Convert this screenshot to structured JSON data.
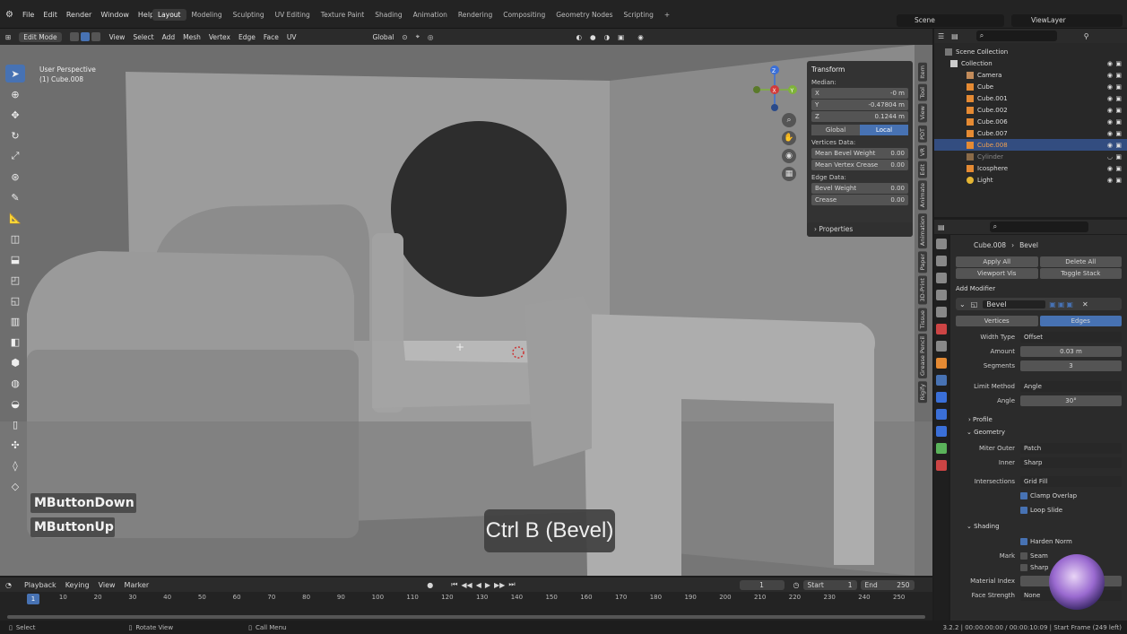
{
  "app": {
    "menu": [
      "File",
      "Edit",
      "Render",
      "Window",
      "Help"
    ],
    "workspaces": [
      "Layout",
      "Modeling",
      "Sculpting",
      "UV Editing",
      "Texture Paint",
      "Shading",
      "Animation",
      "Rendering",
      "Compositing",
      "Geometry Nodes",
      "Scripting"
    ],
    "active_workspace": "Layout",
    "scene": "Scene",
    "view_layer": "ViewLayer"
  },
  "viewport_header": {
    "mode": "Edit Mode",
    "menus": [
      "View",
      "Select",
      "Add",
      "Mesh",
      "Vertex",
      "Edge",
      "Face",
      "UV"
    ],
    "orientation": "Global",
    "options": "Options",
    "xyz": [
      "X",
      "Y",
      "Z"
    ]
  },
  "viewport": {
    "view": "User Perspective",
    "object": "(1) Cube.008"
  },
  "gizmo": {
    "x": "X",
    "y": "Y",
    "z": "Z"
  },
  "npanel": {
    "transform": "Transform",
    "median": "Median:",
    "x_label": "X",
    "x_val": "-0 m",
    "y_label": "Y",
    "y_val": "-0.47804 m",
    "z_label": "Z",
    "z_val": "0.1244 m",
    "global": "Global",
    "local": "Local",
    "vertices_data": "Vertices Data:",
    "mean_bevel_weight": "Mean Bevel Weight",
    "mbw_val": "0.00",
    "mean_vertex_crease": "Mean Vertex Crease",
    "mvc_val": "0.00",
    "edge_data": "Edge Data:",
    "bevel_weight": "Bevel Weight",
    "bw_val": "0.00",
    "crease": "Crease",
    "cr_val": "0.00",
    "properties": "Properties"
  },
  "side_tabs": [
    "Item",
    "Tool",
    "View",
    "PDT",
    "VR",
    "Edit",
    "Animate",
    "Animation",
    "Paper",
    "3D-Print",
    "Tissue",
    "Grease Pencil",
    "Rigify"
  ],
  "keys": {
    "down": "MButtonDown",
    "up": "MButtonUp"
  },
  "caption": "Ctrl B (Bevel)",
  "outliner": {
    "scene_collection": "Scene Collection",
    "collection": "Collection",
    "items": [
      {
        "name": "Camera"
      },
      {
        "name": "Cube"
      },
      {
        "name": "Cube.001"
      },
      {
        "name": "Cube.002"
      },
      {
        "name": "Cube.006"
      },
      {
        "name": "Cube.007"
      },
      {
        "name": "Cube.008"
      },
      {
        "name": "Cylinder"
      },
      {
        "name": "Icosphere"
      },
      {
        "name": "Light"
      }
    ],
    "selected": "Cube.008"
  },
  "properties": {
    "breadcrumb_obj": "Cube.008",
    "breadcrumb_mod": "Bevel",
    "apply_all": "Apply All",
    "delete_all": "Delete All",
    "viewport_vis": "Viewport Vis",
    "toggle_stack": "Toggle Stack",
    "add_modifier": "Add Modifier",
    "modifier_name": "Bevel",
    "vertices": "Vertices",
    "edges": "Edges",
    "width_type_label": "Width Type",
    "width_type": "Offset",
    "amount_label": "Amount",
    "amount": "0.03 m",
    "segments_label": "Segments",
    "segments": "3",
    "limit_method_label": "Limit Method",
    "limit_method": "Angle",
    "angle_label": "Angle",
    "angle": "30°",
    "profile": "Profile",
    "geometry": "Geometry",
    "miter_outer_label": "Miter Outer",
    "miter_outer": "Patch",
    "inner_label": "Inner",
    "inner": "Sharp",
    "intersections_label": "Intersections",
    "intersections": "Grid Fill",
    "clamp_overlap": "Clamp Overlap",
    "loop_slide": "Loop Slide",
    "shading": "Shading",
    "harden_normals": "Harden Norm",
    "mark_label": "Mark",
    "seam": "Seam",
    "sharp": "Sharp",
    "material_index": "Material Index",
    "face_strength": "Face Strength",
    "face_strength_val": "None"
  },
  "timeline": {
    "menus": [
      "Playback",
      "Keying",
      "View",
      "Marker"
    ],
    "current": "1",
    "start_label": "Start",
    "start": "1",
    "end_label": "End",
    "end": "250",
    "ticks": [
      "1",
      "10",
      "20",
      "30",
      "40",
      "50",
      "60",
      "70",
      "80",
      "90",
      "100",
      "110",
      "120",
      "130",
      "140",
      "150",
      "160",
      "170",
      "180",
      "190",
      "200",
      "210",
      "220",
      "230",
      "240",
      "250"
    ]
  },
  "status": {
    "select": "Select",
    "rotate": "Rotate View",
    "call_menu": "Call Menu",
    "version": "3.2.2",
    "time": "00:00:00:00 / 00:00:10:09",
    "start_frame": "Start Frame (249 left)"
  }
}
